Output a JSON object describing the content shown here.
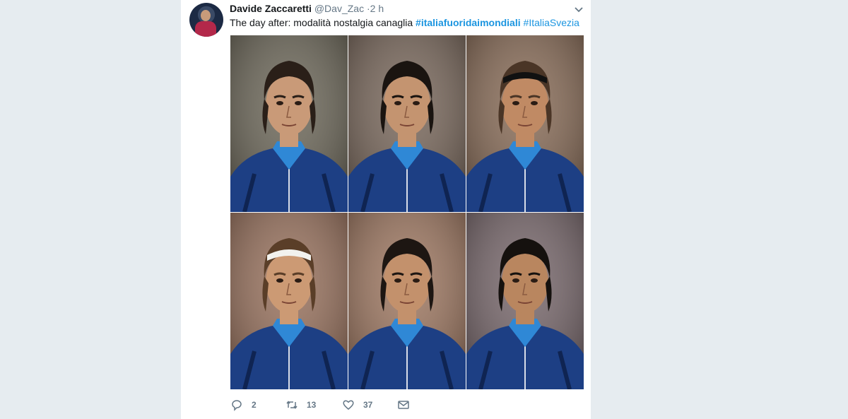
{
  "tweet": {
    "author_name": "Davide Zaccaretti",
    "handle": "@Dav_Zac",
    "separator": "·",
    "time": "2 h",
    "text_prefix": "The day after: modalità nostalgia canaglia ",
    "hashtag_1": "#italiafuoridaimondiali",
    "hashtag_2": "#ItaliaSvezia"
  },
  "media": {
    "portraits": [
      {
        "hair": "#2a1f18",
        "skin": "#c99a78",
        "bg": "#6f6a5c",
        "headband": false
      },
      {
        "hair": "#1a1410",
        "skin": "#c49470",
        "bg": "#7b6a5e",
        "headband": false
      },
      {
        "hair": "#4a3526",
        "skin": "#c08a64",
        "bg": "#8a6e5a",
        "headband": true,
        "headband_color": "#111111"
      },
      {
        "hair": "#5a3e28",
        "skin": "#cc9a74",
        "bg": "#9a7460",
        "headband": true,
        "headband_color": "#f2f2ee"
      },
      {
        "hair": "#1d1612",
        "skin": "#c3916c",
        "bg": "#a07a64",
        "headband": false
      },
      {
        "hair": "#15110e",
        "skin": "#b9865f",
        "bg": "#7a6a6e",
        "headband": false
      }
    ],
    "jersey_color": "#1d3f84",
    "collar_color": "#2f88d6",
    "jacket_trim": "#0f2452"
  },
  "actions": {
    "reply_count": "2",
    "retweet_count": "13",
    "like_count": "37"
  },
  "colors": {
    "page_bg": "#e6ecf0",
    "card_bg": "#ffffff",
    "link": "#1b95e0",
    "muted": "#657786"
  }
}
